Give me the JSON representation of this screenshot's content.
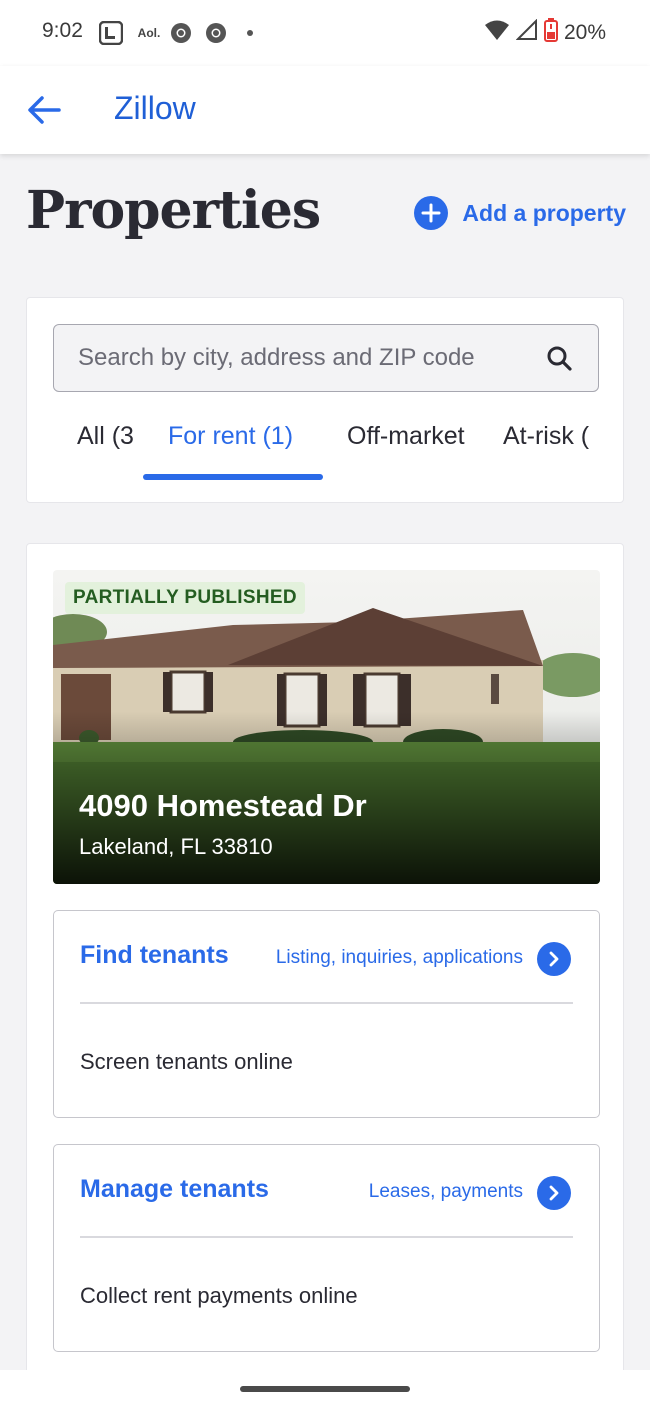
{
  "status_bar": {
    "time": "9:02",
    "notification_icons": [
      "linkedin-icon",
      "aol-icon",
      "chrome-icon",
      "chrome-icon",
      "dot-icon"
    ],
    "aol_label": "Aol.",
    "battery": "20%",
    "battery_color": "#e53935"
  },
  "app_bar": {
    "title": "Zillow"
  },
  "header": {
    "title": "Properties",
    "add_property_label": "Add a property"
  },
  "search": {
    "placeholder": "Search by city, address and ZIP code",
    "value": ""
  },
  "tabs": [
    {
      "label": "All (3"
    },
    {
      "label": "For rent (1)"
    },
    {
      "label": "Off-market"
    },
    {
      "label": "At-risk ("
    }
  ],
  "active_tab": "For rent (1)",
  "property": {
    "status_badge": "PARTIALLY PUBLISHED",
    "address": "4090 Homestead Dr",
    "city": "Lakeland, FL 33810",
    "actions": [
      {
        "title": "Find tenants",
        "subtitle": "Listing, inquiries, applications",
        "body": "Screen tenants online"
      },
      {
        "title": "Manage tenants",
        "subtitle": "Leases, payments",
        "body": "Collect rent payments online"
      }
    ]
  },
  "colors": {
    "accent": "#2a6ae8",
    "app_title": "#1f5fd6",
    "badge_bg": "#e3f1dc",
    "badge_text": "#245d21",
    "page_bg": "#f3f3f5"
  }
}
